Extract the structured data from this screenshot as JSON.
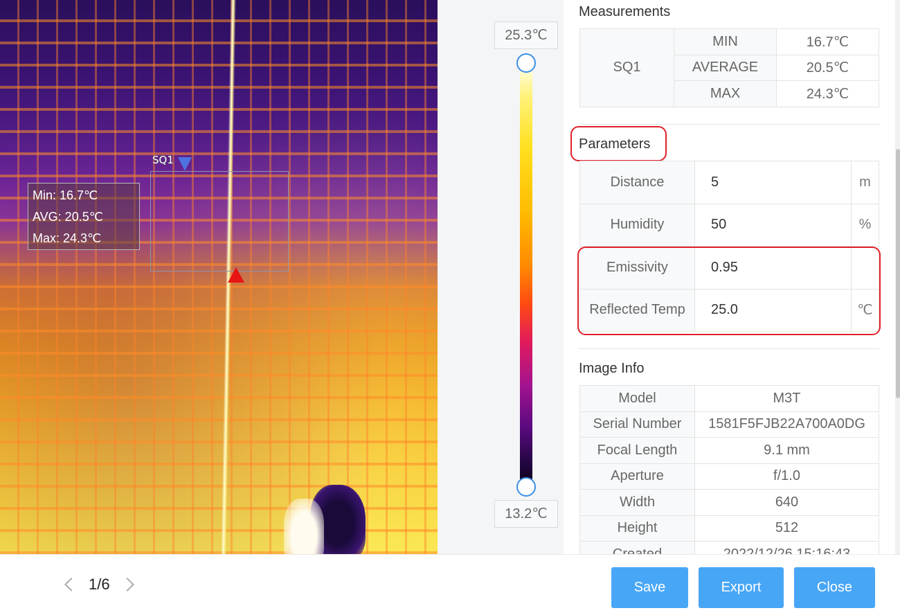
{
  "image": {
    "roi_label": "SQ1",
    "stats": {
      "min": "Min: 16.7℃",
      "avg": "AVG: 20.5℃",
      "max": "Max: 24.3℃"
    }
  },
  "scale": {
    "max_value": "25.3℃",
    "min_value": "13.2℃"
  },
  "measurements": {
    "title": "Measurements",
    "roi": "SQ1",
    "rows": [
      {
        "label": "MIN",
        "value": "16.7℃"
      },
      {
        "label": "AVERAGE",
        "value": "20.5℃"
      },
      {
        "label": "MAX",
        "value": "24.3℃"
      }
    ]
  },
  "parameters": {
    "title": "Parameters",
    "rows": [
      {
        "label": "Distance",
        "value": "5",
        "unit": "m"
      },
      {
        "label": "Humidity",
        "value": "50",
        "unit": "%"
      },
      {
        "label": "Emissivity",
        "value": "0.95",
        "unit": ""
      },
      {
        "label": "Reflected Temp",
        "value": "25.0",
        "unit": "℃"
      }
    ]
  },
  "image_info": {
    "title": "Image Info",
    "rows": [
      {
        "label": "Model",
        "value": "M3T"
      },
      {
        "label": "Serial Number",
        "value": "1581F5FJB22A700A0DG"
      },
      {
        "label": "Focal Length",
        "value": "9.1 mm"
      },
      {
        "label": "Aperture",
        "value": "f/1.0"
      },
      {
        "label": "Width",
        "value": "640"
      },
      {
        "label": "Height",
        "value": "512"
      },
      {
        "label": "Created",
        "value": "2022/12/26 15:16:43"
      }
    ]
  },
  "footer": {
    "page_indicator": "1/6",
    "save_label": "Save",
    "export_label": "Export",
    "close_label": "Close"
  },
  "colors": {
    "primary_button": "#48a6f6",
    "highlight": "#e0202a",
    "handle_border": "#3b8fe8"
  },
  "icons": [
    "chevron-left-icon",
    "chevron-right-icon",
    "roi-marker-max-icon",
    "roi-marker-min-icon"
  ]
}
